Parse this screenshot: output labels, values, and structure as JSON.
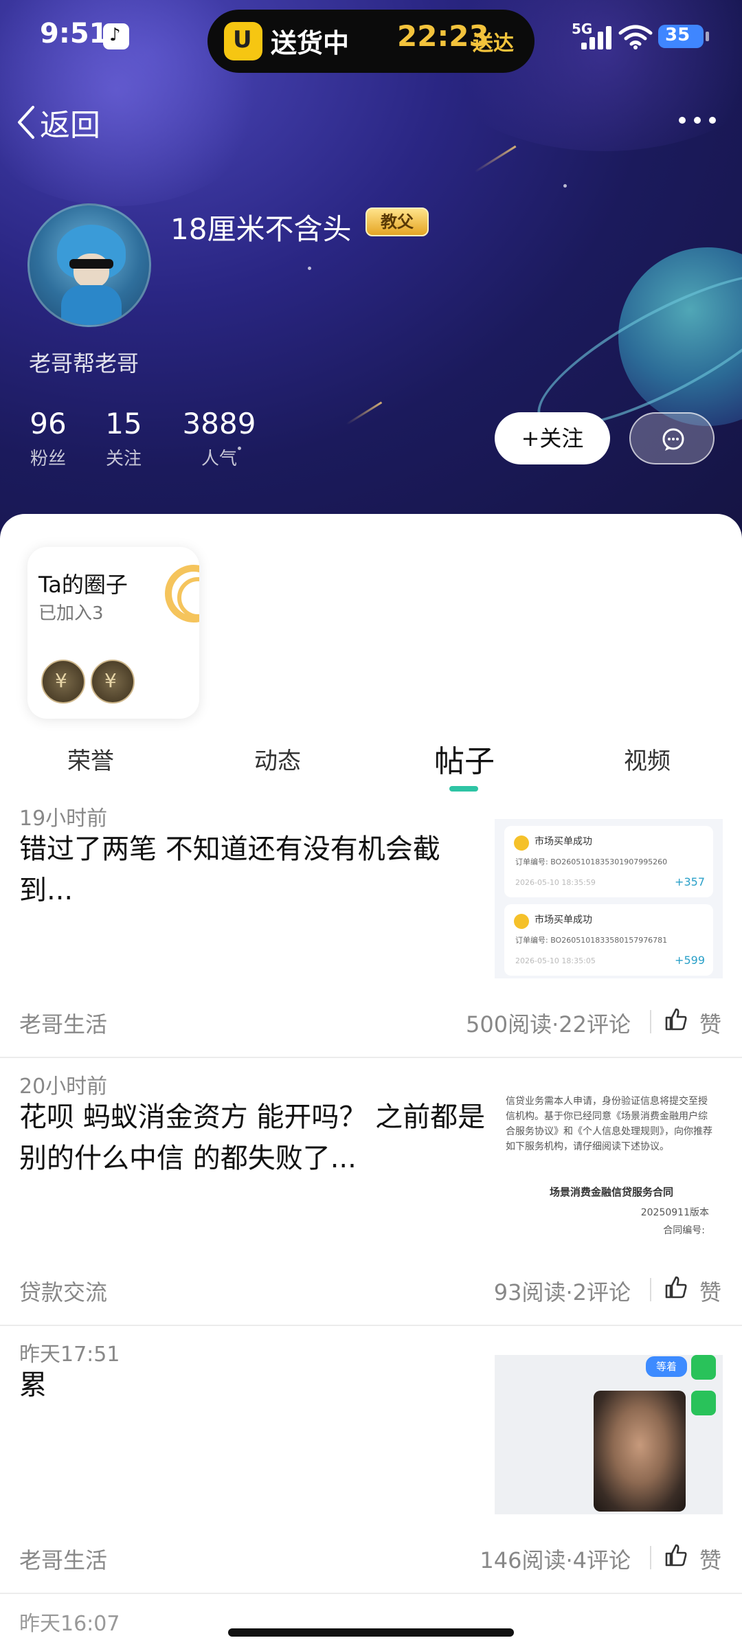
{
  "status_bar": {
    "time": "9:51",
    "island_text": "送货中",
    "island_time": "22:23",
    "island_time_label": "送达",
    "network": "5G",
    "battery": "35"
  },
  "nav": {
    "back_label": "返回"
  },
  "profile": {
    "username": "18厘米不含头",
    "badge": "教父",
    "bio": "老哥帮老哥",
    "stats": [
      {
        "value": "96",
        "label": "粉丝"
      },
      {
        "value": "15",
        "label": "关注"
      },
      {
        "value": "3889",
        "label": "人气"
      }
    ],
    "follow_label": "+关注"
  },
  "circle_card": {
    "title": "Ta的圈子",
    "subtitle": "已加入3"
  },
  "tabs": [
    {
      "label": "荣誉"
    },
    {
      "label": "动态"
    },
    {
      "label": "帖子"
    },
    {
      "label": "视频"
    }
  ],
  "posts": [
    {
      "time": "19小时前",
      "text": "错过了两笔 不知道还有没有机会截到...",
      "tag": "老哥生活",
      "stats": "500阅读·22评论",
      "like_label": "赞",
      "thumb": {
        "orders": [
          {
            "title": "市场买单成功",
            "id": "订单编号: BO2605101835301907995260",
            "date": "2026-05-10 18:35:59",
            "amount": "+357"
          },
          {
            "title": "市场买单成功",
            "id": "订单编号: BO2605101833580157976781",
            "date": "2026-05-10 18:35:05",
            "amount": "+599"
          }
        ]
      }
    },
    {
      "time": "20小时前",
      "text": " 花呗 蚂蚁消金资方 能开吗？ 之前都是 别的什么中信 的都失败了...",
      "tag": "贷款交流",
      "stats": "93阅读·2评论",
      "like_label": "赞",
      "thumb": {
        "lines": [
          "信贷业务需本人申请，身份验证信息将提交至授信机构。基于你已经同意《场景消费金融用户综合服务协议》和《个人信息处理规则》，向你推荐如下服务机构，请仔细阅读下述协议。"
        ],
        "title": "场景消费金融信贷服务合同",
        "version": "20250911版本",
        "contract_no": "合同编号:"
      }
    },
    {
      "time": "昨天17:51",
      "text": "累",
      "tag": "老哥生活",
      "stats": "146阅读·4评论",
      "like_label": "赞",
      "thumb": {
        "bubble": "等着"
      }
    }
  ],
  "next_post_time": "昨天16:07"
}
